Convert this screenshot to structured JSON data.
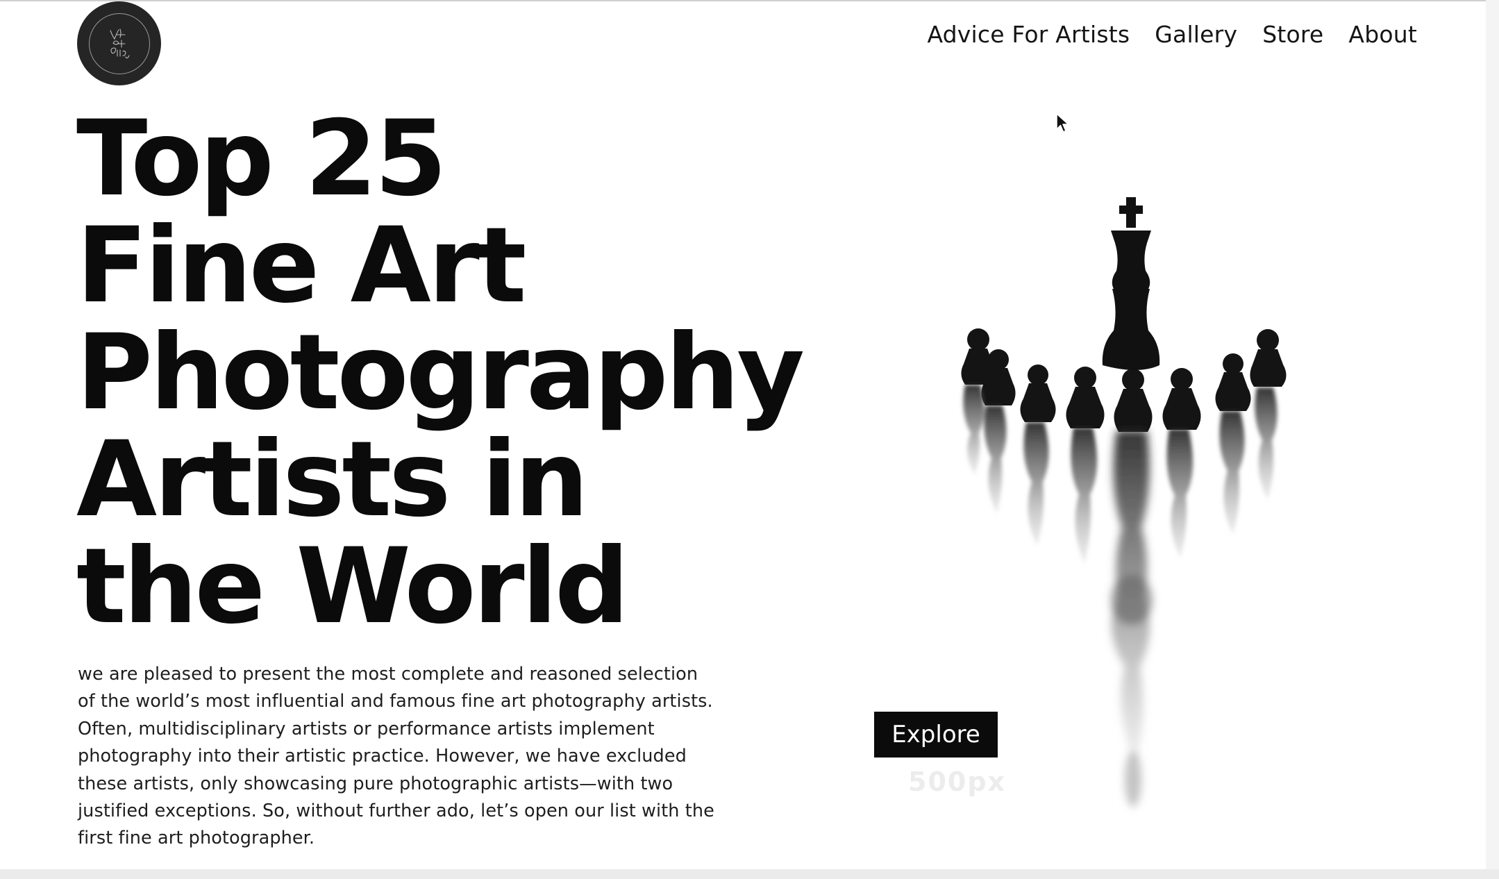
{
  "header": {
    "logo_alt": "Virtual Art Gallery",
    "nav": [
      {
        "label": "Advice For Artists"
      },
      {
        "label": "Gallery"
      },
      {
        "label": "Store"
      },
      {
        "label": "About"
      }
    ]
  },
  "hero": {
    "title_lines": [
      "Top 25",
      "Fine Art",
      "Photography",
      "Artists in",
      "the World"
    ],
    "intro": "we are pleased to present the most complete and reasoned selection of the world’s most influential and famous fine art photography artists. Often, multidisciplinary artists or performance artists implement photography into their artistic practice. However, we have excluded these artists, only showcasing pure photographic artists—with two justified exceptions. So, without further ado, let’s open our list with the first fine art photographer.",
    "explore_label": "Explore",
    "ghost_label": "500px",
    "image_subject": "chess-pieces-reflection-photo"
  },
  "colors": {
    "text": "#0b0b0b",
    "button_bg": "#0b0b0b",
    "button_text": "#ffffff",
    "logo_bg": "#252525"
  }
}
